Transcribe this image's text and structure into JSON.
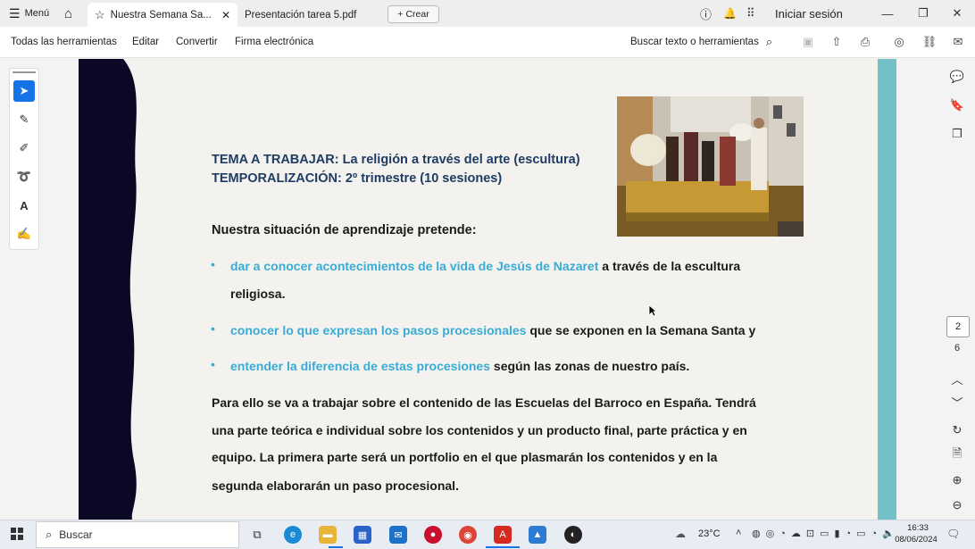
{
  "titlebar": {
    "menu_label": "Menú",
    "tabs": [
      {
        "label": "Nuestra Semana Sa...",
        "active": true
      },
      {
        "label": "Presentación tarea 5.pdf",
        "active": false
      }
    ],
    "new_tab_label": "Crear",
    "signin_label": "Iniciar sesión"
  },
  "toolbar": {
    "items": [
      "Todas las herramientas",
      "Editar",
      "Convertir",
      "Firma electrónica"
    ],
    "search_label": "Buscar texto o herramientas"
  },
  "document": {
    "title_line1": "TEMA A TRABAJAR: La religión a través del arte (escultura)",
    "title_line2": "TEMPORALIZACIÓN: 2º trimestre (10 sesiones)",
    "intro": "Nuestra situación de aprendizaje pretende:",
    "bullets": [
      {
        "highlight": "dar a conocer acontecimientos de la vida de Jesús de Nazaret",
        "rest": " a través de la escultura",
        "line2": "religiosa."
      },
      {
        "highlight": "conocer lo que expresan los pasos procesionales",
        "rest": " que se exponen en la Semana Santa y",
        "line2": ""
      },
      {
        "highlight": "entender la diferencia de estas procesiones",
        "rest": " según las zonas de nuestro país.",
        "line2": ""
      }
    ],
    "paragraph_lines": [
      "Para ello se va a trabajar sobre el contenido de las Escuelas del Barroco en España. Tendrá",
      "una parte teórica e individual sobre los contenidos y un producto final, parte práctica y en",
      "equipo. La primera parte será un portfolio en el que plasmarán los contenidos y en la",
      "segunda elaborarán un paso procesional."
    ],
    "colors": {
      "highlight": "#39acd6",
      "title": "#1f3d64",
      "teal": "#73c1c6",
      "dark": "#0b0826"
    }
  },
  "pages": {
    "current": "2",
    "total": "6"
  },
  "taskbar": {
    "search_placeholder": "Buscar",
    "temperature": "23°C",
    "time": "16:33",
    "date": "08/06/2024"
  }
}
